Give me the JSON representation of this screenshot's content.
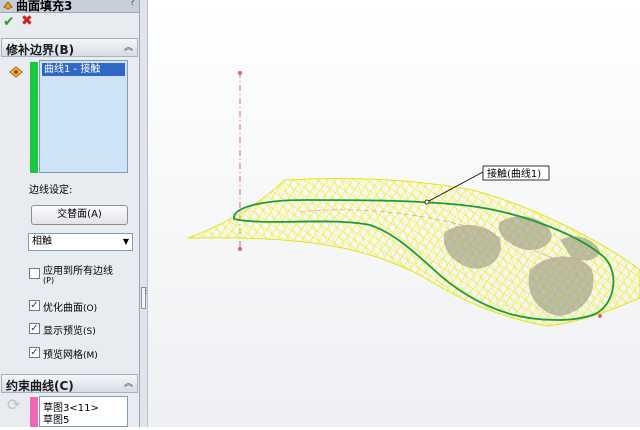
{
  "feature": {
    "title": "曲面填充3",
    "help": "?"
  },
  "actions": {
    "ok": "✔",
    "cancel": "✖"
  },
  "boundary_section": {
    "title": "修补边界(B)",
    "items": [
      "曲线1 - 接触"
    ],
    "edge_settings_label": "边线设定:",
    "alternate_face_button": "交替面(A)",
    "condition": "相触",
    "checkboxes": [
      {
        "label": "应用到所有边线",
        "sub": "(P)",
        "checked": false
      },
      {
        "label": "优化曲面",
        "sub": "(O)",
        "checked": true
      },
      {
        "label": "显示预览",
        "sub": "(S)",
        "checked": true
      },
      {
        "label": "预览网格",
        "sub": "(M)",
        "checked": true
      }
    ]
  },
  "constraint_section": {
    "title": "约束曲线(C)",
    "items": [
      "草图3<11>",
      "草图5"
    ]
  },
  "viewport": {
    "callout": "接触(曲线1)"
  },
  "colors": {
    "mesh": "#f2ee1c",
    "boundary": "#1e9c3a",
    "ok": "#21a321",
    "cancel": "#d21c1c"
  }
}
